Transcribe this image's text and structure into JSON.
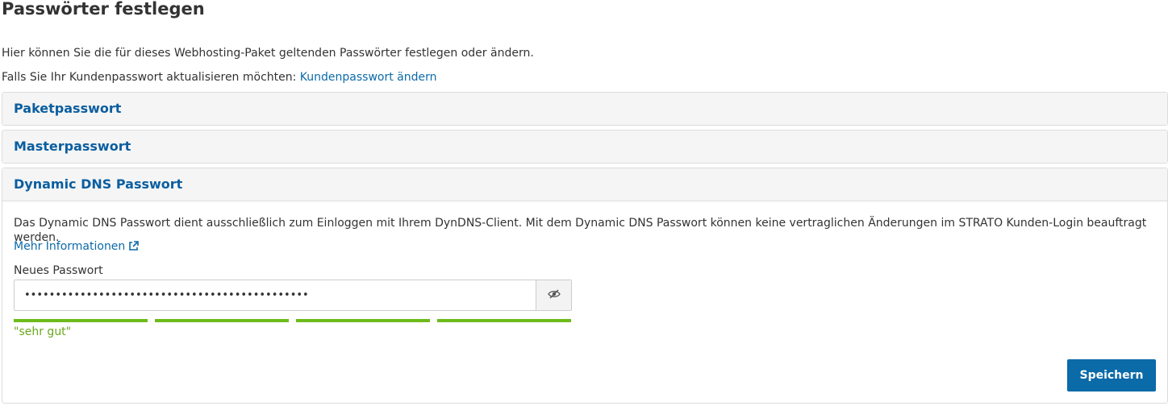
{
  "page": {
    "title": "Passwörter festlegen",
    "intro": "Hier können Sie die für dieses Webhosting-Paket geltenden Passwörter festlegen oder ändern.",
    "customer_hint": "Falls Sie Ihr Kundenpasswort aktualisieren möchten: ",
    "customer_link": "Kundenpasswort ändern"
  },
  "panels": [
    {
      "title": "Paketpasswort"
    },
    {
      "title": "Masterpasswort"
    },
    {
      "title": "Dynamic DNS Passwort",
      "description": "Das Dynamic DNS Passwort dient ausschließlich zum Einloggen mit Ihrem DynDNS-Client. Mit dem Dynamic DNS Passwort können keine vertraglichen Änderungen im STRATO Kunden-Login beauftragt werden.",
      "more_link": "Mehr Informationen",
      "field_label": "Neues Passwort",
      "password_value": "••••••••••••••••••••••••••••••••••••••••••••••",
      "strength_level": 4,
      "strength_max": 4,
      "strength_label": "\"sehr gut\"",
      "strength_color": "#6dbb1a",
      "toggle_icon": "eye-slash-icon",
      "save_label": "Speichern"
    }
  ],
  "colors": {
    "link": "#0b6aa8",
    "button": "#0b6aa8",
    "panel_header_bg": "#f5f5f5"
  }
}
